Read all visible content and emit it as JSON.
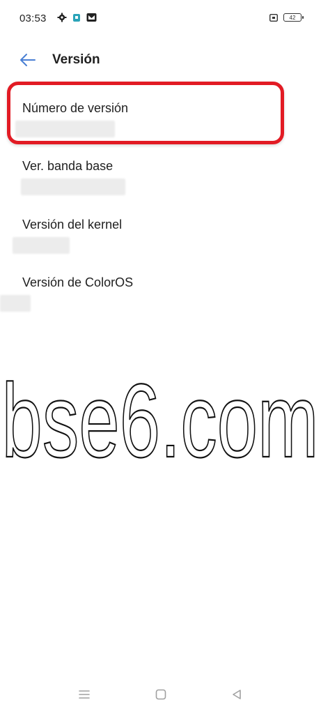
{
  "status_bar": {
    "time": "03:53",
    "battery": "42",
    "icons_left": [
      "gear-icon",
      "app-icon",
      "mail-icon"
    ],
    "icons_right": [
      "screen-icon",
      "battery-icon"
    ]
  },
  "header": {
    "title": "Versión",
    "back_icon": "back-arrow-icon",
    "accent_color": "#4a7fd4"
  },
  "items": [
    {
      "label": "Número de versión"
    },
    {
      "label": "Ver. banda base"
    },
    {
      "label": "Versión del kernel"
    },
    {
      "label": "Versión de ColorOS"
    }
  ],
  "watermark": {
    "text": "bse6.com"
  },
  "highlight_color": "#e21b24",
  "nav_bar": {
    "icons": [
      "menu-icon",
      "home-icon",
      "back-icon"
    ]
  }
}
